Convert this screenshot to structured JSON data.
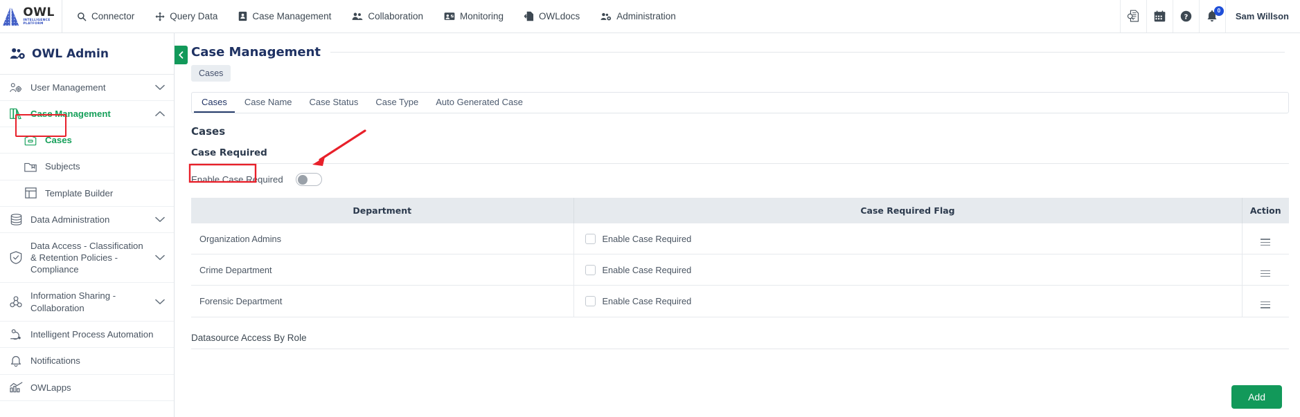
{
  "brand": {
    "name": "OWL",
    "tagline": "INTELLIGENCE PLATFORM",
    "logo_blue": "#2d4bbd",
    "accent_green": "#12995a",
    "title_navy": "#1f3263",
    "annotation_red": "#e8202a"
  },
  "topnav": {
    "items": [
      {
        "label": "Connector",
        "icon": "search-icon"
      },
      {
        "label": "Query Data",
        "icon": "move-arrows-icon"
      },
      {
        "label": "Case Management",
        "icon": "case-book-icon"
      },
      {
        "label": "Collaboration",
        "icon": "people-icon"
      },
      {
        "label": "Monitoring",
        "icon": "monitor-person-icon"
      },
      {
        "label": "OWLdocs",
        "icon": "document-arrow-icon"
      },
      {
        "label": "Administration",
        "icon": "admin-gear-people-icon"
      }
    ],
    "right_icons": [
      {
        "name": "audit-document-icon",
        "glyph": "ὍC"
      },
      {
        "name": "calendar-icon",
        "glyph": "Ὄ5"
      },
      {
        "name": "help-icon",
        "glyph": "?"
      },
      {
        "name": "notifications-bell-icon",
        "glyph": "ὑ4"
      }
    ],
    "notification_count": "0",
    "user": "Sam Willson"
  },
  "sidebar": {
    "title": "OWL Admin",
    "title_icon": "people-gear-icon",
    "items": [
      {
        "label": "User Management",
        "icon": "users-gear-icon",
        "expandable": true,
        "expanded": false,
        "level": 0,
        "active": false
      },
      {
        "label": "Case Management",
        "icon": "books-icon",
        "expandable": true,
        "expanded": true,
        "level": 0,
        "active": true
      },
      {
        "label": "Cases",
        "icon": "case-box-icon",
        "expandable": false,
        "level": 1,
        "active": true,
        "highlighted": true
      },
      {
        "label": "Subjects",
        "icon": "folder-bookmark-icon",
        "expandable": false,
        "level": 1,
        "active": false
      },
      {
        "label": "Template Builder",
        "icon": "layout-template-icon",
        "expandable": false,
        "level": 1,
        "active": false
      },
      {
        "label": "Data Administration",
        "icon": "database-icon",
        "expandable": true,
        "expanded": false,
        "level": 0,
        "active": false
      },
      {
        "label": "Data Access - Classification & Retention Policies - Compliance",
        "icon": "shield-check-icon",
        "expandable": true,
        "expanded": false,
        "level": 0,
        "active": false
      },
      {
        "label": "Information Sharing - Collaboration",
        "icon": "share-nodes-icon",
        "expandable": true,
        "expanded": false,
        "level": 0,
        "active": false
      },
      {
        "label": "Intelligent Process Automation",
        "icon": "automation-robot-icon",
        "expandable": false,
        "level": 0,
        "active": false
      },
      {
        "label": "Notifications",
        "icon": "bell-icon",
        "expandable": false,
        "level": 0,
        "active": false
      },
      {
        "label": "OWLapps",
        "icon": "chart-apps-icon",
        "expandable": false,
        "level": 0,
        "active": false
      }
    ]
  },
  "main": {
    "page_title": "Case Management",
    "collapse_icon": "chevron-left-icon",
    "breadcrumb": "Cases",
    "tabs": [
      {
        "label": "Cases",
        "active": true
      },
      {
        "label": "Case Name",
        "active": false
      },
      {
        "label": "Case Status",
        "active": false
      },
      {
        "label": "Case Type",
        "active": false
      },
      {
        "label": "Auto Generated Case",
        "active": false
      }
    ],
    "section_title": "Cases",
    "case_required": {
      "heading": "Case Required",
      "toggle_label": "Enable Case Required",
      "toggle_state": "off"
    },
    "table": {
      "columns": [
        "Department",
        "Case Required Flag",
        "Action"
      ],
      "rows": [
        {
          "department": "Organization Admins",
          "flag_label": "Enable Case Required",
          "flag_checked": false,
          "action_icon": "hamburger-menu-icon"
        },
        {
          "department": "Crime Department",
          "flag_label": "Enable Case Required",
          "flag_checked": false,
          "action_icon": "hamburger-menu-icon"
        },
        {
          "department": "Forensic Department",
          "flag_label": "Enable Case Required",
          "flag_checked": false,
          "action_icon": "hamburger-menu-icon"
        }
      ]
    },
    "footer_section_title": "Datasource Access By Role",
    "add_button": "Add"
  }
}
